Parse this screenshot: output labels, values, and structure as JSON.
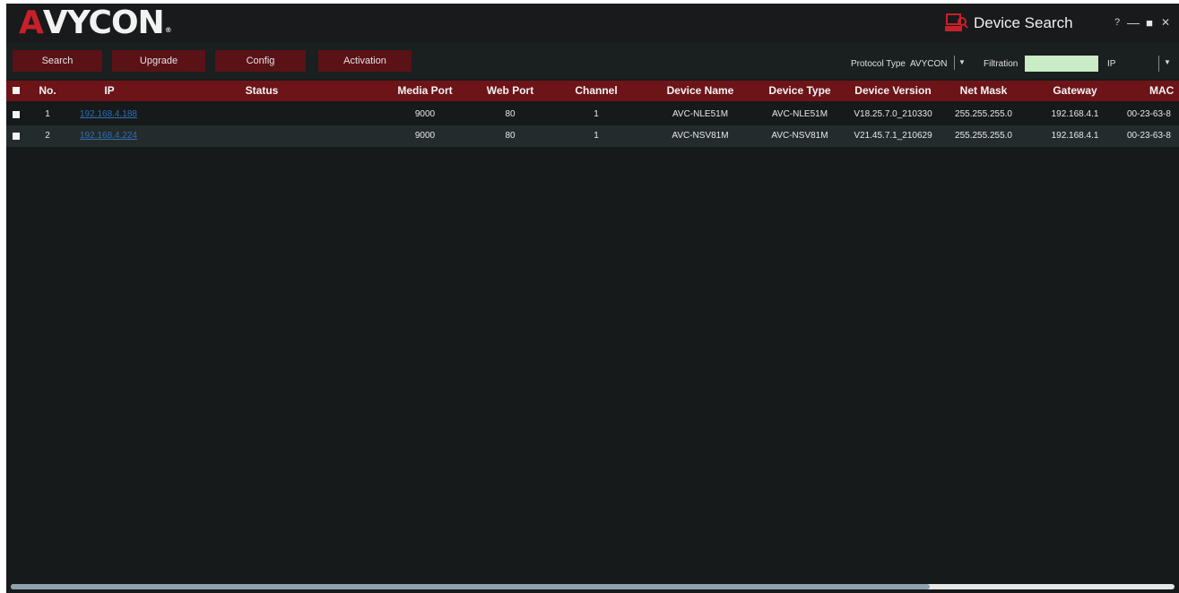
{
  "window": {
    "logo": {
      "a": "A",
      "rest": "VYCON",
      "reg": "®"
    },
    "title": "Device Search",
    "controls": {
      "help": "?",
      "minimize": "—",
      "maximize": "■",
      "close": "✕"
    }
  },
  "toolbar": {
    "buttons": [
      "Search",
      "Upgrade",
      "Config",
      "Activation"
    ],
    "protocol_label": "Protocol Type",
    "protocol_value": "AVYCON",
    "filtration_label": "Filtration",
    "filtration_value": "",
    "filter_type": "IP"
  },
  "table": {
    "columns": [
      "No.",
      "IP",
      "Status",
      "Media Port",
      "Web Port",
      "Channel",
      "Device Name",
      "Device Type",
      "Device Version",
      "Net Mask",
      "Gateway",
      "MAC"
    ],
    "rows": [
      {
        "no": "1",
        "ip": "192.168.4.188",
        "status": "",
        "media_port": "9000",
        "web_port": "80",
        "channel": "1",
        "device_name": "AVC-NLE51M",
        "device_type": "AVC-NLE51M",
        "device_version": "V18.25.7.0_210330",
        "net_mask": "255.255.255.0",
        "gateway": "192.168.4.1",
        "mac": "00-23-63-8"
      },
      {
        "no": "2",
        "ip": "192.168.4.224",
        "status": "",
        "media_port": "9000",
        "web_port": "80",
        "channel": "1",
        "device_name": "AVC-NSV81M",
        "device_type": "AVC-NSV81M",
        "device_version": "V21.45.7.1_210629",
        "net_mask": "255.255.255.0",
        "gateway": "192.168.4.1",
        "mac": "00-23-63-8"
      }
    ]
  },
  "colors": {
    "brand_red": "#c8202a",
    "header_red": "#6d1419",
    "button_red": "#5a1216",
    "background": "#161a1b",
    "link_blue": "#2f6fb8",
    "filter_green": "#c9ecc7"
  },
  "horizontal_scroll": 0.79
}
